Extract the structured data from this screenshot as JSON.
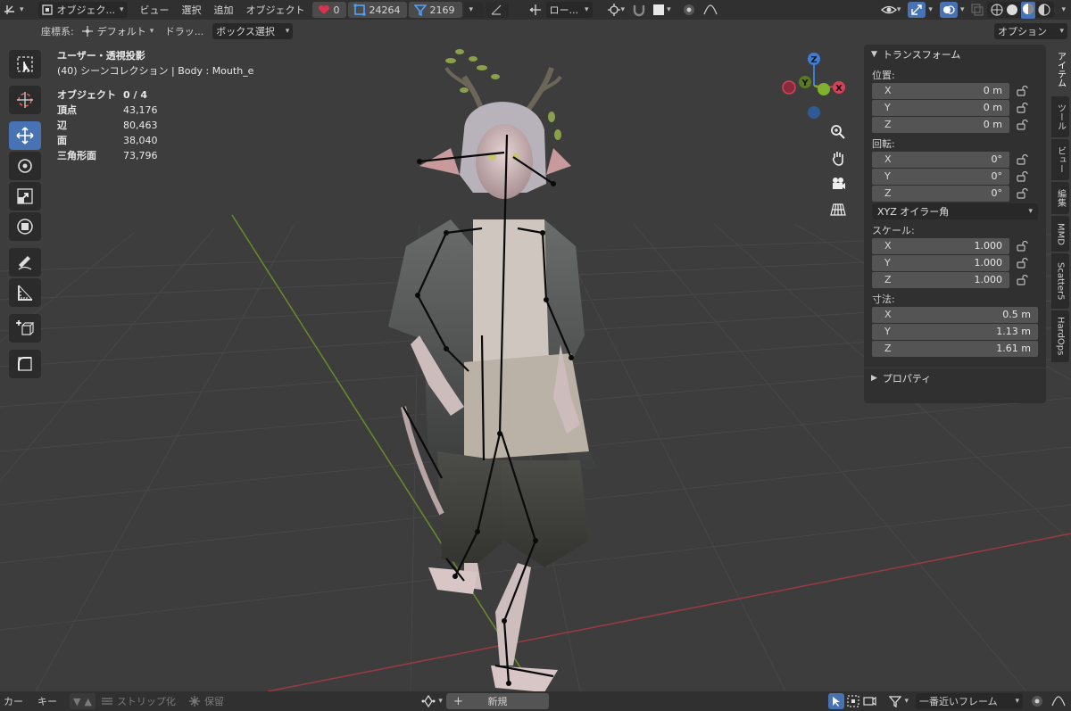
{
  "top_bar": {
    "mode_label": "オブジェク...",
    "menus": [
      "ビュー",
      "選択",
      "追加",
      "オブジェクト"
    ],
    "shape_keys": "0",
    "vertex_count": "24264",
    "face_count": "2169",
    "transform_orientation": "ロー..."
  },
  "tool_header": {
    "coord_label": "座標系:",
    "coord_value": "デフォルト",
    "drag_label": "ドラッ...",
    "drag_value": "ボックス選択",
    "options_label": "オプション"
  },
  "viewport": {
    "view_name": "ユーザー・透視投影",
    "collection": "(40) シーンコレクション | Body : Mouth_e",
    "stats": [
      {
        "label": "オブジェクト",
        "value": "0 / 4"
      },
      {
        "label": "頂点",
        "value": "43,176"
      },
      {
        "label": "辺",
        "value": "80,463"
      },
      {
        "label": "面",
        "value": "38,040"
      },
      {
        "label": "三角形面",
        "value": "73,796"
      }
    ],
    "gizmo": {
      "x": "X",
      "y": "Y",
      "z": "Z"
    }
  },
  "n_panel": {
    "transform_title": "トランスフォーム",
    "location_label": "位置:",
    "location": [
      {
        "axis": "X",
        "value": "0 m"
      },
      {
        "axis": "Y",
        "value": "0 m"
      },
      {
        "axis": "Z",
        "value": "0 m"
      }
    ],
    "rotation_label": "回転:",
    "rotation": [
      {
        "axis": "X",
        "value": "0°"
      },
      {
        "axis": "Y",
        "value": "0°"
      },
      {
        "axis": "Z",
        "value": "0°"
      }
    ],
    "rotation_mode": "XYZ オイラー角",
    "scale_label": "スケール:",
    "scale": [
      {
        "axis": "X",
        "value": "1.000"
      },
      {
        "axis": "Y",
        "value": "1.000"
      },
      {
        "axis": "Z",
        "value": "1.000"
      }
    ],
    "dimensions_label": "寸法:",
    "dimensions": [
      {
        "axis": "X",
        "value": "0.5 m"
      },
      {
        "axis": "Y",
        "value": "1.13 m"
      },
      {
        "axis": "Z",
        "value": "1.61 m"
      }
    ],
    "properties_title": "プロパティ"
  },
  "side_tabs": [
    "アイテム",
    "ツール",
    "ビュー",
    "編集",
    "MMD",
    "Scatter5",
    "HardOps"
  ],
  "bottom_bar": {
    "marker": "カー",
    "key": "キー",
    "strip": "ストリップ化",
    "keep": "保留",
    "new_label": "新規",
    "keying": "一番近いフレーム"
  },
  "colors": {
    "header_bg": "#303030",
    "viewport_bg": "#3d3d3d",
    "accent_blue": "#4772b3",
    "axis_x": "#d3415a",
    "axis_y": "#7fb22e",
    "axis_z": "#3b7fd6"
  }
}
